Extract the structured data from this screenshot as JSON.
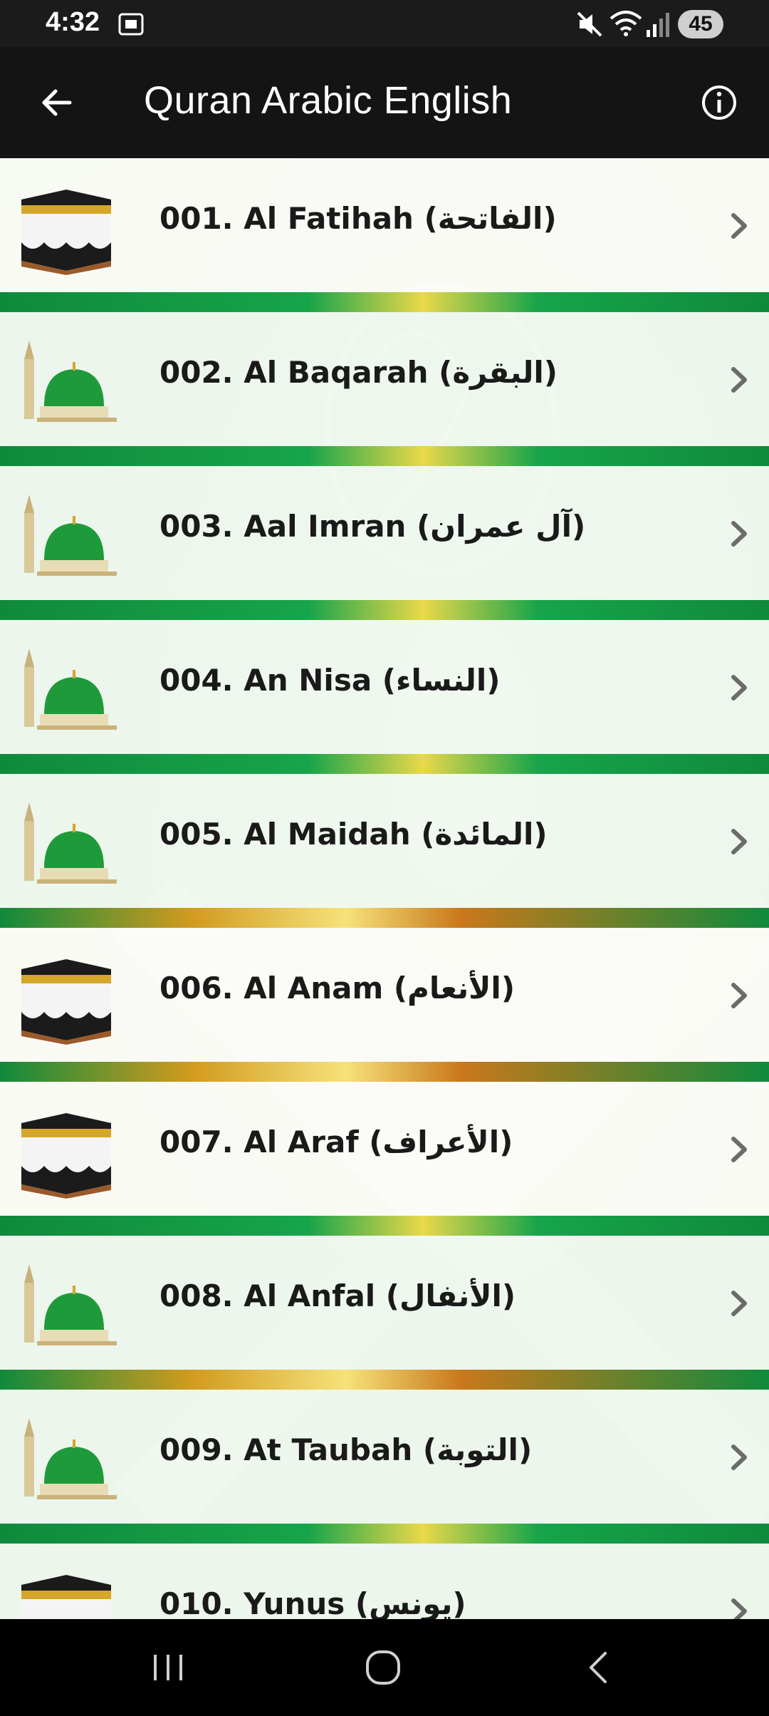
{
  "status": {
    "time": "4:32",
    "battery": "45",
    "icons": [
      "screenshot-icon",
      "mute-icon",
      "wifi-icon",
      "signal-icon",
      "battery-icon"
    ]
  },
  "app_bar": {
    "title": "Quran Arabic English",
    "back_icon": "arrow-left-icon",
    "info_icon": "info-icon"
  },
  "surahs": [
    {
      "label": "001. Al Fatihah (الفاتحة)",
      "icon": "kaaba"
    },
    {
      "label": "002. Al Baqarah (البقرة)",
      "icon": "mosque"
    },
    {
      "label": "003. Aal Imran (آل عمران)",
      "icon": "mosque"
    },
    {
      "label": "004. An Nisa (النساء)",
      "icon": "mosque"
    },
    {
      "label": "005. Al Maidah (المائدة)",
      "icon": "mosque"
    },
    {
      "label": "006. Al Anam (الأنعام)",
      "icon": "kaaba"
    },
    {
      "label": "007. Al Araf (الأعراف)",
      "icon": "kaaba"
    },
    {
      "label": "008. Al Anfal (الأنفال)",
      "icon": "mosque"
    },
    {
      "label": "009. At Taubah (التوبة)",
      "icon": "mosque"
    },
    {
      "label": "010. Yunus (يونس)",
      "icon": "kaaba"
    }
  ],
  "nav": [
    "recents-icon",
    "home-icon",
    "back-icon"
  ]
}
